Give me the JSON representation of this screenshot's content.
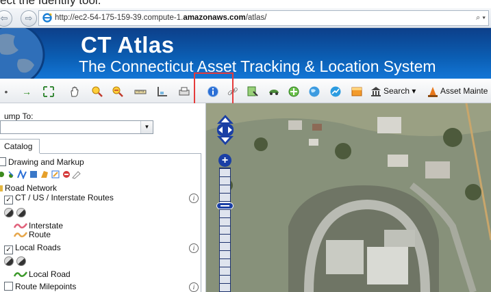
{
  "caption": "ect the Identify tool.",
  "browser": {
    "url_prefix": "http://ec2-54-175-159-39.compute-1.",
    "url_domain": "amazonaws.com",
    "url_suffix": "/atlas/",
    "search_icon": "search-icon",
    "actions": "⌕ ▾"
  },
  "banner": {
    "title": "CT Atlas",
    "subtitle": "The Connecticut Asset Tracking & Location System"
  },
  "toolbar": {
    "search_label": "Search",
    "asset_label": "Asset Mainte",
    "highlighted_tool": "identify-tool"
  },
  "left_panel": {
    "jump_label": "ump To:",
    "catalog_tab": "Catalog",
    "drawing_markup": "Drawing and Markup",
    "road_network": "Road Network",
    "ct_routes": "CT / US / Interstate Routes",
    "legend_interstate": "Interstate",
    "legend_route": "Route",
    "local_roads": "Local Roads",
    "legend_local_road": "Local Road",
    "route_milepoints": "Route Milepoints",
    "info_glyph": "i"
  },
  "colors": {
    "banner": "#0b5fb5",
    "highlight": "#e53b3b",
    "zoom_control": "#1a3fa5"
  }
}
